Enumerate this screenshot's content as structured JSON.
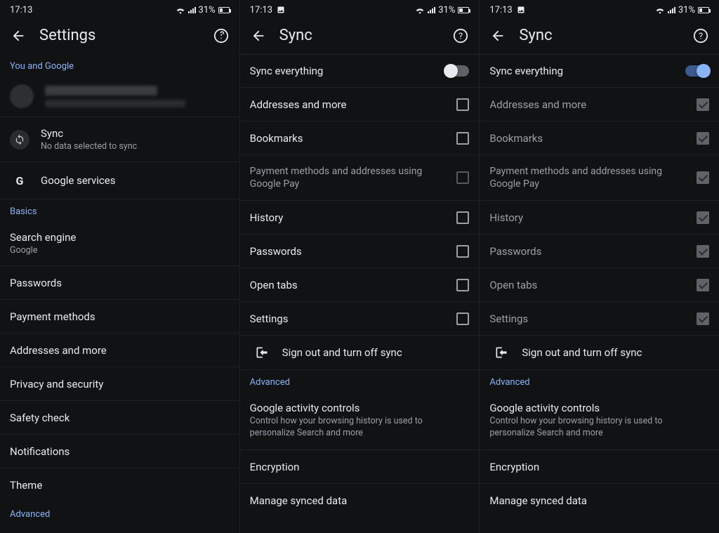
{
  "status": {
    "time": "17:13",
    "battery": "31%"
  },
  "panel1": {
    "title": "Settings",
    "section_you": "You and Google",
    "sync": {
      "title": "Sync",
      "sub": "No data selected to sync"
    },
    "google_services": "Google services",
    "section_basics": "Basics",
    "search_engine": {
      "label": "Search engine",
      "value": "Google"
    },
    "items": {
      "passwords": "Passwords",
      "payment": "Payment methods",
      "addresses": "Addresses and more",
      "privacy": "Privacy and security",
      "safety": "Safety check",
      "notifications": "Notifications",
      "theme": "Theme"
    },
    "section_advanced": "Advanced"
  },
  "panel2": {
    "title": "Sync",
    "sync_everything": "Sync everything",
    "items": {
      "addresses": "Addresses and more",
      "bookmarks": "Bookmarks",
      "payment_gpay": "Payment methods and addresses using Google Pay",
      "history": "History",
      "passwords": "Passwords",
      "open_tabs": "Open tabs",
      "settings": "Settings"
    },
    "signout": "Sign out and turn off sync",
    "section_advanced": "Advanced",
    "activity": {
      "label": "Google activity controls",
      "sub": "Control how your browsing history is used to personalize Search and more"
    },
    "encryption": "Encryption",
    "manage": "Manage synced data"
  },
  "panel3": {
    "title": "Sync",
    "sync_everything": "Sync everything",
    "items": {
      "addresses": "Addresses and more",
      "bookmarks": "Bookmarks",
      "payment_gpay": "Payment methods and addresses using Google Pay",
      "history": "History",
      "passwords": "Passwords",
      "open_tabs": "Open tabs",
      "settings": "Settings"
    },
    "signout": "Sign out and turn off sync",
    "section_advanced": "Advanced",
    "activity": {
      "label": "Google activity controls",
      "sub": "Control how your browsing history is used to personalize Search and more"
    },
    "encryption": "Encryption",
    "manage": "Manage synced data"
  }
}
